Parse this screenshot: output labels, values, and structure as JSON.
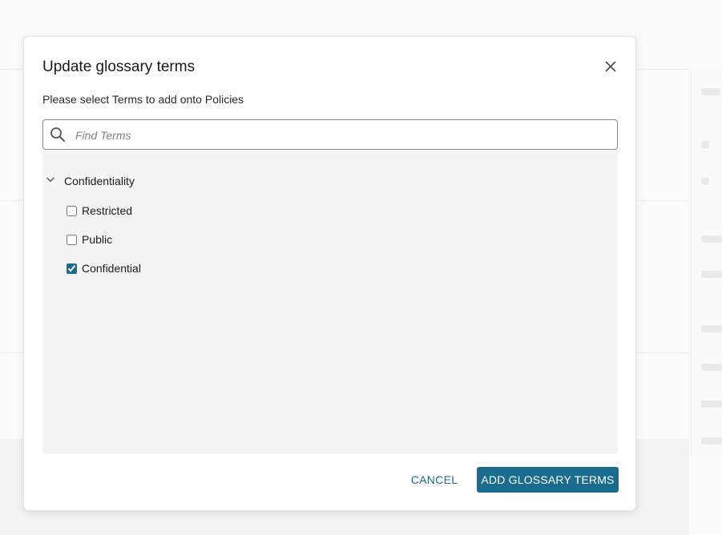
{
  "dialog": {
    "title": "Update glossary terms",
    "subtitle": "Please select Terms to add onto Policies",
    "close_icon": "close-icon"
  },
  "search": {
    "placeholder": "Find Terms",
    "value": "",
    "icon": "search-icon"
  },
  "tree": {
    "category": {
      "label": "Confidentiality",
      "expanded": true,
      "toggle_icon": "chevron-down-icon"
    },
    "terms": [
      {
        "label": "Restricted",
        "checked": false
      },
      {
        "label": "Public",
        "checked": false
      },
      {
        "label": "Confidential",
        "checked": true
      }
    ]
  },
  "actions": {
    "cancel_label": "CANCEL",
    "submit_label": "ADD GLOSSARY TERMS"
  },
  "colors": {
    "accent": "#1b6b8f",
    "panel_background": "#f4f4f4",
    "search_border": "#8a8a8a"
  }
}
